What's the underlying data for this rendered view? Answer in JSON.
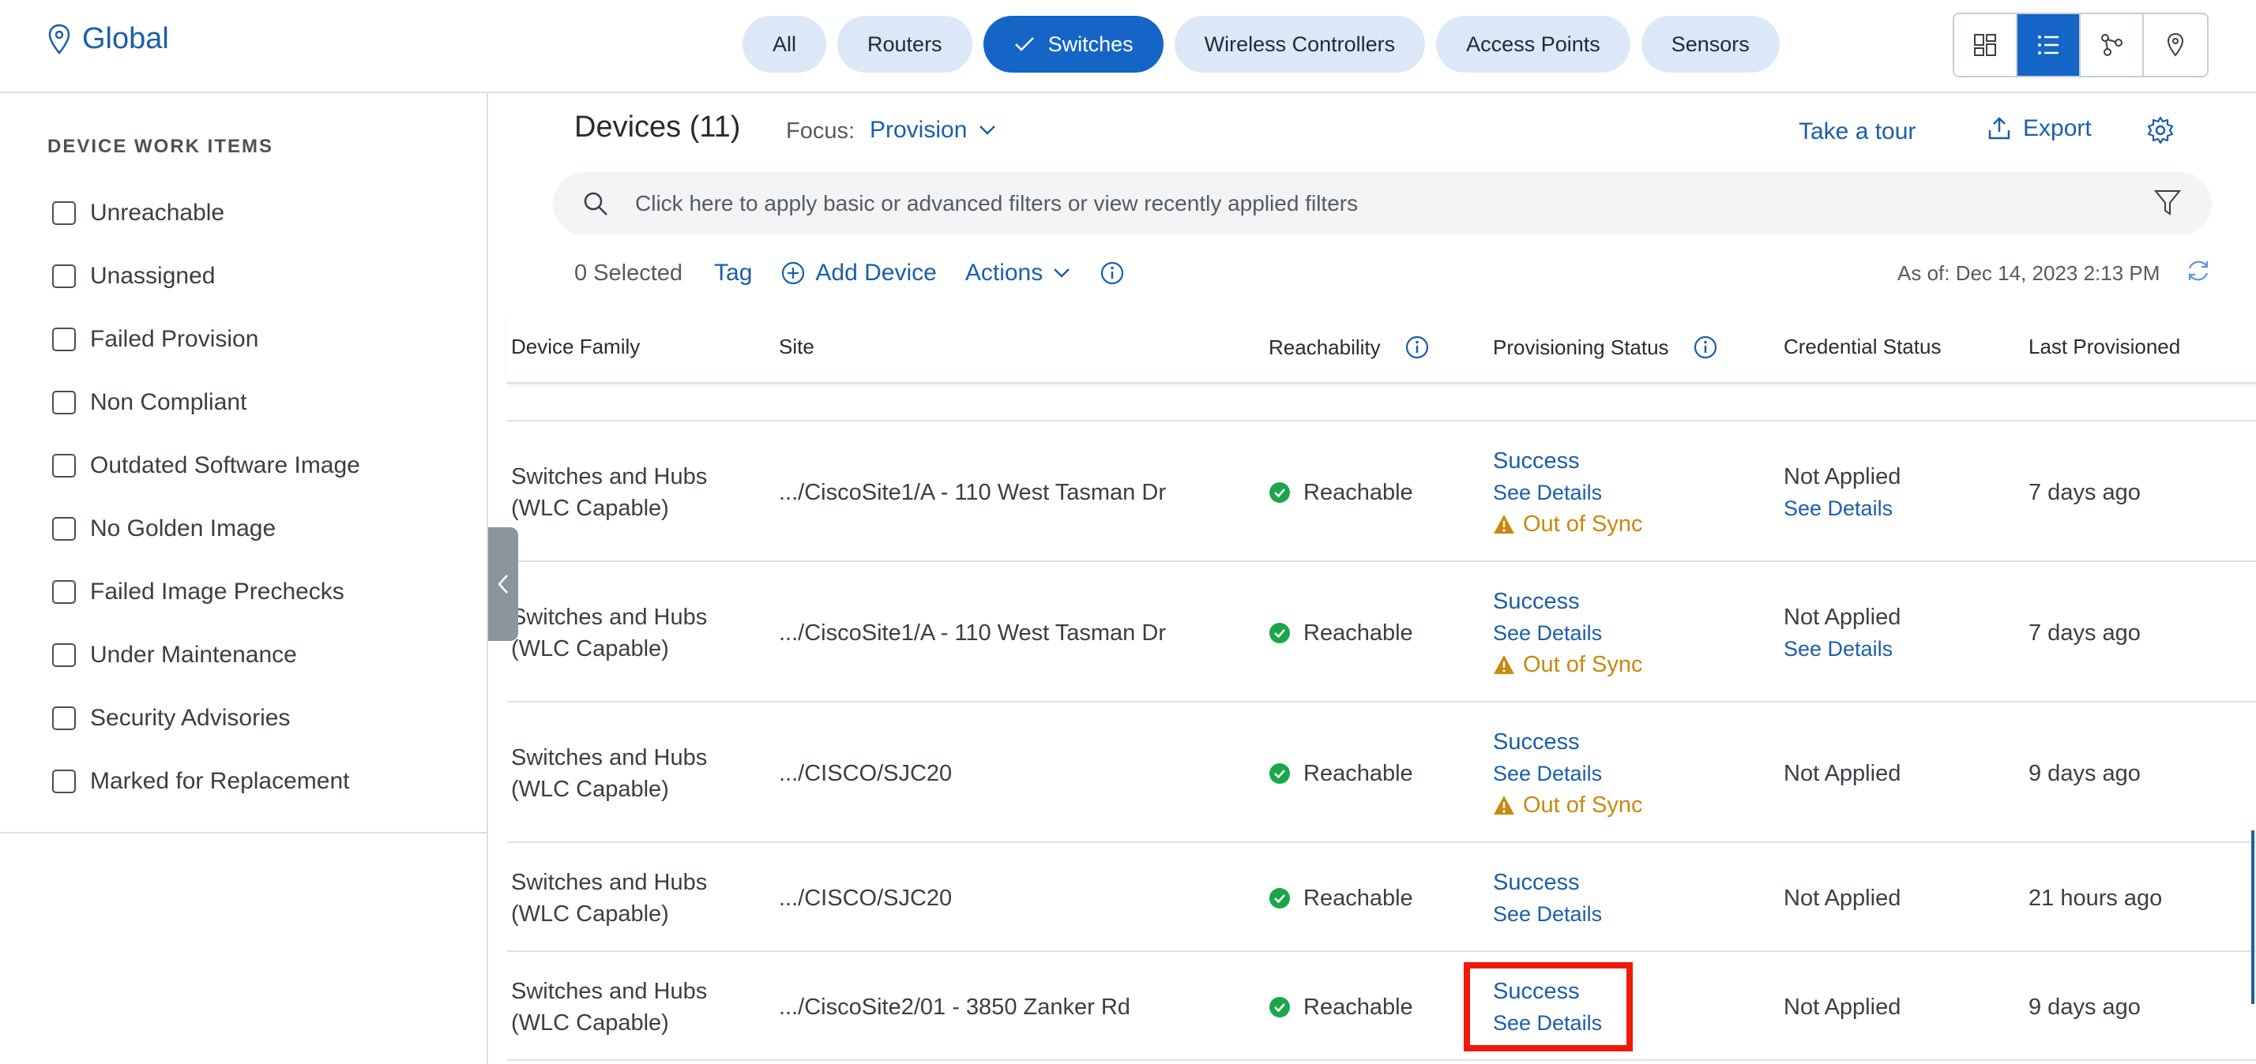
{
  "header": {
    "location": "Global",
    "device_type_tabs": [
      {
        "label": "All",
        "active": false
      },
      {
        "label": "Routers",
        "active": false
      },
      {
        "label": "Switches",
        "active": true
      },
      {
        "label": "Wireless Controllers",
        "active": false
      },
      {
        "label": "Access Points",
        "active": false
      },
      {
        "label": "Sensors",
        "active": false
      }
    ],
    "view_toggles": [
      "grid-view-icon",
      "list-view-icon",
      "topology-view-icon",
      "map-view-icon"
    ],
    "active_view": "list-view-icon"
  },
  "work_items": {
    "title": "DEVICE WORK ITEMS",
    "items": [
      "Unreachable",
      "Unassigned",
      "Failed Provision",
      "Non Compliant",
      "Outdated Software Image",
      "No Golden Image",
      "Failed Image Prechecks",
      "Under Maintenance",
      "Security Advisories",
      "Marked for Replacement"
    ]
  },
  "main": {
    "title": "Devices (11)",
    "focus_label": "Focus:",
    "focus_value": "Provision",
    "tour_label": "Take a tour",
    "export_label": "Export",
    "filter_placeholder": "Click here to apply basic or advanced filters or view recently applied filters",
    "selected_count": "0 Selected",
    "tag_label": "Tag",
    "add_device_label": "Add Device",
    "actions_label": "Actions",
    "as_of": "As of: Dec 14, 2023 2:13 PM"
  },
  "table": {
    "columns": [
      "Device Family",
      "Site",
      "Reachability",
      "Provisioning Status",
      "Credential Status",
      "Last Provisioned"
    ],
    "rows": [
      {
        "family1": "Switches and Hubs",
        "family2": "(WLC Capable)",
        "site": ".../CiscoSite1/A - 110 West Tasman Dr",
        "reachability": "Reachable",
        "prov_status": "Success",
        "prov_details": "See Details",
        "sync": "Out of Sync",
        "cred_status": "Not Applied",
        "cred_details": "See Details",
        "last": "7 days ago"
      },
      {
        "family1": "Switches and Hubs",
        "family2": "(WLC Capable)",
        "site": ".../CiscoSite1/A - 110 West Tasman Dr",
        "reachability": "Reachable",
        "prov_status": "Success",
        "prov_details": "See Details",
        "sync": "Out of Sync",
        "cred_status": "Not Applied",
        "cred_details": "See Details",
        "last": "7 days ago"
      },
      {
        "family1": "Switches and Hubs",
        "family2": "(WLC Capable)",
        "site": ".../CISCO/SJC20",
        "reachability": "Reachable",
        "prov_status": "Success",
        "prov_details": "See Details",
        "sync": "Out of Sync",
        "cred_status": "Not Applied",
        "last": "9 days ago"
      },
      {
        "family1": "Switches and Hubs",
        "family2": "(WLC Capable)",
        "site": ".../CISCO/SJC20",
        "reachability": "Reachable",
        "prov_status": "Success",
        "prov_details": "See Details",
        "cred_status": "Not Applied",
        "last": "21 hours ago"
      },
      {
        "family1": "Switches and Hubs",
        "family2": "(WLC Capable)",
        "site": ".../CiscoSite2/01 - 3850 Zanker Rd",
        "reachability": "Reachable",
        "prov_status": "Success",
        "prov_details": "See Details",
        "cred_status": "Not Applied",
        "last": "9 days ago"
      }
    ]
  },
  "colors": {
    "accent": "#1565c7",
    "link": "#1b5fa8",
    "success": "#1aa64a",
    "warning": "#c9880e",
    "highlight": "#f01a0a"
  }
}
